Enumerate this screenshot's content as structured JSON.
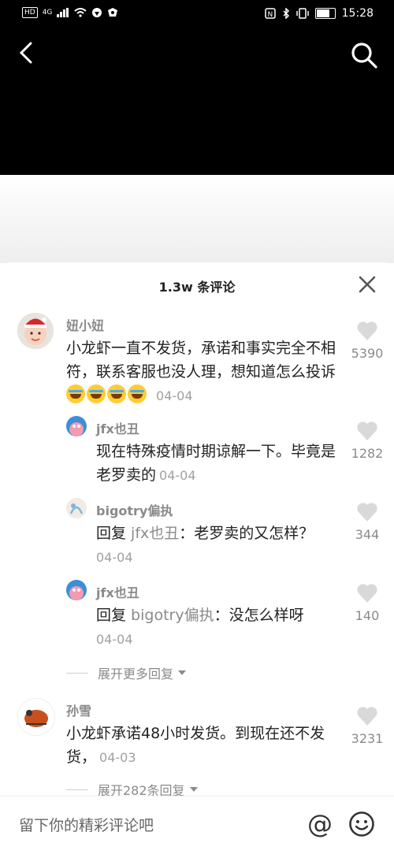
{
  "status": {
    "left_chip": "HD",
    "network": "4G",
    "time": "15:28"
  },
  "sheet": {
    "title": "1.3w 条评论"
  },
  "comments": [
    {
      "user": "妞小妞",
      "text": "小龙虾一直不发货，承诺和事实完全不相符，联系客服也没人理，想知道怎么投诉",
      "emoji_count": 4,
      "date": "04-04",
      "likes": "5390",
      "replies": [
        {
          "user": "jfx也丑",
          "text": "现在特殊疫情时期谅解一下。毕竟是老罗卖的",
          "date": "04-04",
          "likes": "1282"
        },
        {
          "user": "bigotry偏执",
          "prefix": "回复 ",
          "reply_to": "jfx也丑",
          "text": "：老罗卖的又怎样？",
          "date": "04-04",
          "likes": "344"
        },
        {
          "user": "jfx也丑",
          "prefix": "回复 ",
          "reply_to": "bigotry偏执",
          "text": "：没怎么样呀",
          "date": "04-04",
          "likes": "140"
        }
      ],
      "expand_label": "展开更多回复"
    },
    {
      "user": "孙雪",
      "text": "小龙虾承诺48小时发货。到现在还不发货，",
      "date": "04-03",
      "likes": "3231",
      "expand_label": "展开282条回复"
    }
  ],
  "input": {
    "placeholder": "留下你的精彩评论吧",
    "at_label": "@"
  },
  "colors": {
    "background_top": "#000000",
    "sheet": "#ffffff",
    "muted_text": "#8a8a8a"
  },
  "icons": [
    "back-arrow-icon",
    "search-icon",
    "close-icon",
    "heart-icon",
    "emoji-icon",
    "chevron-down-icon"
  ]
}
